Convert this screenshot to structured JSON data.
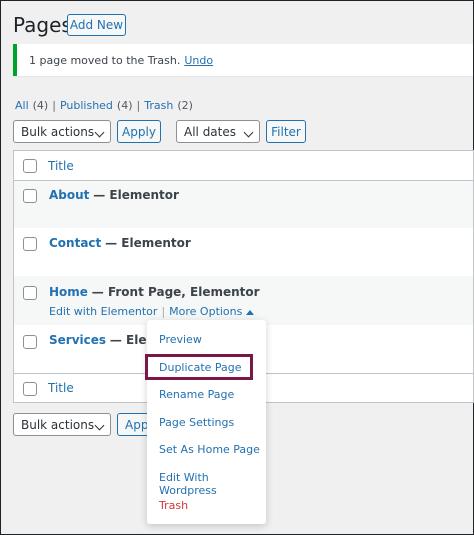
{
  "header": {
    "title": "Pages",
    "add_new": "Add New"
  },
  "notice": {
    "text": "1 page moved to the Trash.",
    "undo": "Undo"
  },
  "views": [
    {
      "label": "All",
      "count": "(4)"
    },
    {
      "label": "Published",
      "count": "(4)"
    },
    {
      "label": "Trash",
      "count": "(2)"
    }
  ],
  "filters": {
    "bulk_actions": "Bulk actions",
    "apply": "Apply",
    "dates": "All dates",
    "filter": "Filter"
  },
  "table": {
    "column_title": "Title",
    "rows": [
      {
        "title": "About",
        "state": "— Elementor"
      },
      {
        "title": "Contact",
        "state": "— Elementor"
      },
      {
        "title": "Home",
        "state": "— Front Page, Elementor",
        "edit_elementor": "Edit with Elementor",
        "more_options": "More Options"
      },
      {
        "title": "Services",
        "state": "— Element"
      }
    ],
    "footer_title": "Title"
  },
  "bottom_filters": {
    "bulk_actions": "Bulk actions",
    "apply": "Appl"
  },
  "menu": {
    "items": [
      "Preview",
      "Duplicate Page",
      "Rename Page",
      "Page Settings",
      "Set As Home Page",
      "Edit With Wordpress",
      "Trash"
    ],
    "trash_color": "#d63638",
    "highlight_color": "#7b1746"
  }
}
